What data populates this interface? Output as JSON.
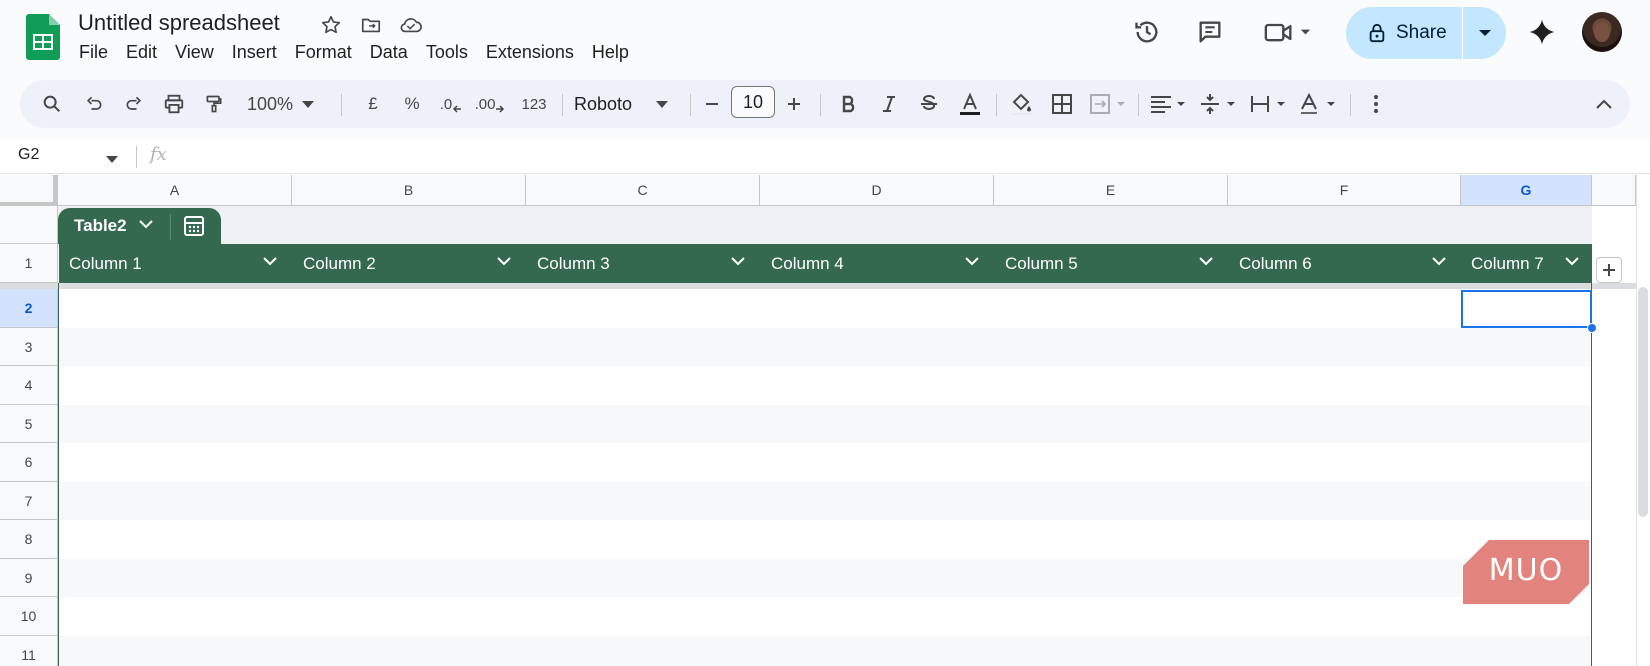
{
  "header": {
    "title": "Untitled spreadsheet",
    "menu": [
      "File",
      "Edit",
      "View",
      "Insert",
      "Format",
      "Data",
      "Tools",
      "Extensions",
      "Help"
    ],
    "share_label": "Share",
    "icons": [
      "star-icon",
      "move-to-folder-icon",
      "cloud-saved-icon",
      "version-history-icon",
      "comments-icon",
      "meet-video-icon",
      "gemini-sparkle-icon"
    ]
  },
  "toolbar": {
    "zoom": "100%",
    "currency": "£",
    "percent": "%",
    "dec_decrease": ".0",
    "dec_increase": ".00",
    "number_format": "123",
    "font": "Roboto",
    "font_size": "10"
  },
  "formula_bar": {
    "cell_ref": "G2",
    "fx_label": "fx",
    "value": ""
  },
  "grid": {
    "columns": [
      "A",
      "B",
      "C",
      "D",
      "E",
      "F",
      "G"
    ],
    "selected_column": "G",
    "rows": [
      "1",
      "2",
      "3",
      "4",
      "5",
      "6",
      "7",
      "8",
      "9",
      "10",
      "11"
    ],
    "selected_row": "2",
    "selected_cell": "G2"
  },
  "table": {
    "name": "Table2",
    "headers": [
      "Column 1",
      "Column 2",
      "Column 3",
      "Column 4",
      "Column 5",
      "Column 6",
      "Column 7"
    ],
    "header_color": "#35694f"
  },
  "watermark": {
    "text": "MUO",
    "color": "#e07a72"
  },
  "colors": {
    "accent_blue": "#1a73e8",
    "share_bg": "#c2e7ff",
    "toolbar_bg": "#edf2fa",
    "sheets_green": "#0f9d58"
  }
}
